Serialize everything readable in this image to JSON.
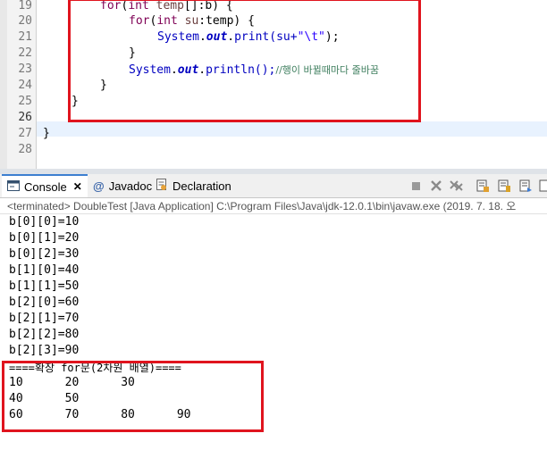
{
  "editor": {
    "line_numbers": [
      "19",
      "20",
      "21",
      "22",
      "23",
      "24",
      "25",
      "26",
      "27",
      "28"
    ],
    "line19": {
      "kw1": "for",
      "p1": "(",
      "kw2": "int",
      "sp": " ",
      "var": "temp",
      "rest": "[]:b) {"
    },
    "line20": {
      "kw1": "for",
      "p1": "(",
      "kw2": "int",
      "sp": " ",
      "var": "su",
      "rest": ":temp) {"
    },
    "line21": {
      "cls": "System",
      "dot1": ".",
      "fld": "out",
      "dot2": ".",
      "mth": "print(su+",
      "str": "\"\\t\"",
      "end": ");"
    },
    "line22": "}",
    "line23": {
      "cls": "System",
      "dot1": ".",
      "fld": "out",
      "dot2": ".",
      "mth": "println();",
      "cmt": "//행이 바뀔때마다 줄바꿈"
    },
    "line24": "}",
    "line25": "}",
    "line27": "}"
  },
  "console": {
    "tabs": {
      "console": "Console",
      "javadoc": "Javadoc",
      "declaration": "Declaration"
    },
    "status": "<terminated> DoubleTest [Java Application] C:\\Program Files\\Java\\jdk-12.0.1\\bin\\javaw.exe (2019. 7. 18. 오",
    "output_lines": [
      "b[0][0]=10",
      "b[0][1]=20",
      "b[0][2]=30",
      "b[1][0]=40",
      "b[1][1]=50",
      "b[2][0]=60",
      "b[2][1]=70",
      "b[2][2]=80",
      "b[2][3]=90",
      "====확장 for문(2차원 배열)====",
      "10      20      30",
      "40      50",
      "60      70      80      90"
    ]
  },
  "colors": {
    "highlight_box": "#e0141e",
    "keyword": "#7f0055",
    "field": "#0000c0",
    "string": "#2a00ff",
    "comment": "#3f7f5f"
  }
}
